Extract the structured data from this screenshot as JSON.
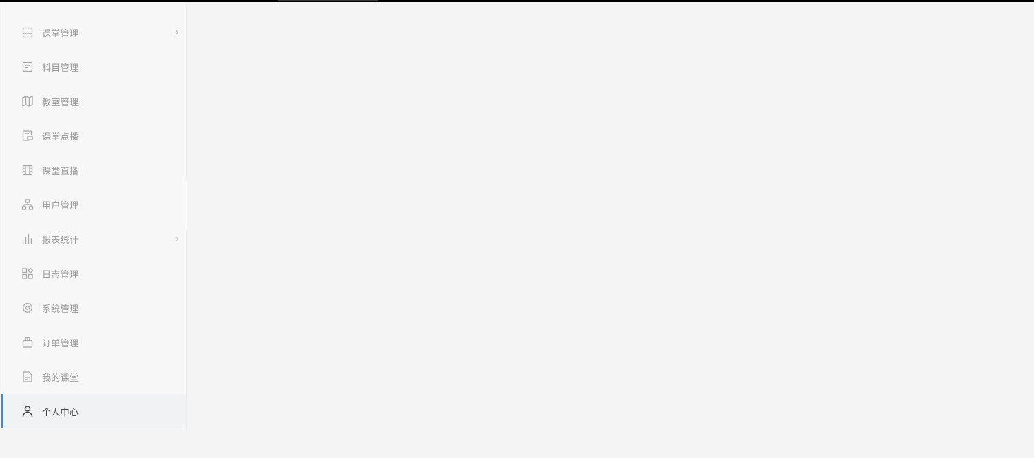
{
  "colors": {
    "accent": "#2b8de5",
    "icon": "#a6a6a6",
    "active_icon": "#444444"
  },
  "sidebar": {
    "items": [
      {
        "label": "课堂管理",
        "icon": "panel-icon",
        "has_submenu": true,
        "active": false
      },
      {
        "label": "科目管理",
        "icon": "document-list-icon",
        "has_submenu": false,
        "active": false
      },
      {
        "label": "教室管理",
        "icon": "map-icon",
        "has_submenu": false,
        "active": false
      },
      {
        "label": "课堂点播",
        "icon": "video-file-icon",
        "has_submenu": false,
        "active": false
      },
      {
        "label": "课堂直播",
        "icon": "film-icon",
        "has_submenu": false,
        "active": false
      },
      {
        "label": "用户管理",
        "icon": "org-chart-icon",
        "has_submenu": false,
        "active": false
      },
      {
        "label": "报表统计",
        "icon": "bar-chart-icon",
        "has_submenu": true,
        "active": false
      },
      {
        "label": "日志管理",
        "icon": "apps-grid-icon",
        "has_submenu": false,
        "active": false
      },
      {
        "label": "系统管理",
        "icon": "settings-icon",
        "has_submenu": false,
        "active": false
      },
      {
        "label": "订单管理",
        "icon": "shopping-bag-icon",
        "has_submenu": false,
        "active": false
      },
      {
        "label": "我的课堂",
        "icon": "file-icon",
        "has_submenu": false,
        "active": false
      },
      {
        "label": "个人中心",
        "icon": "user-icon",
        "has_submenu": false,
        "active": true
      }
    ]
  },
  "collapse_handle": {
    "icon": "chevron-left-icon"
  }
}
